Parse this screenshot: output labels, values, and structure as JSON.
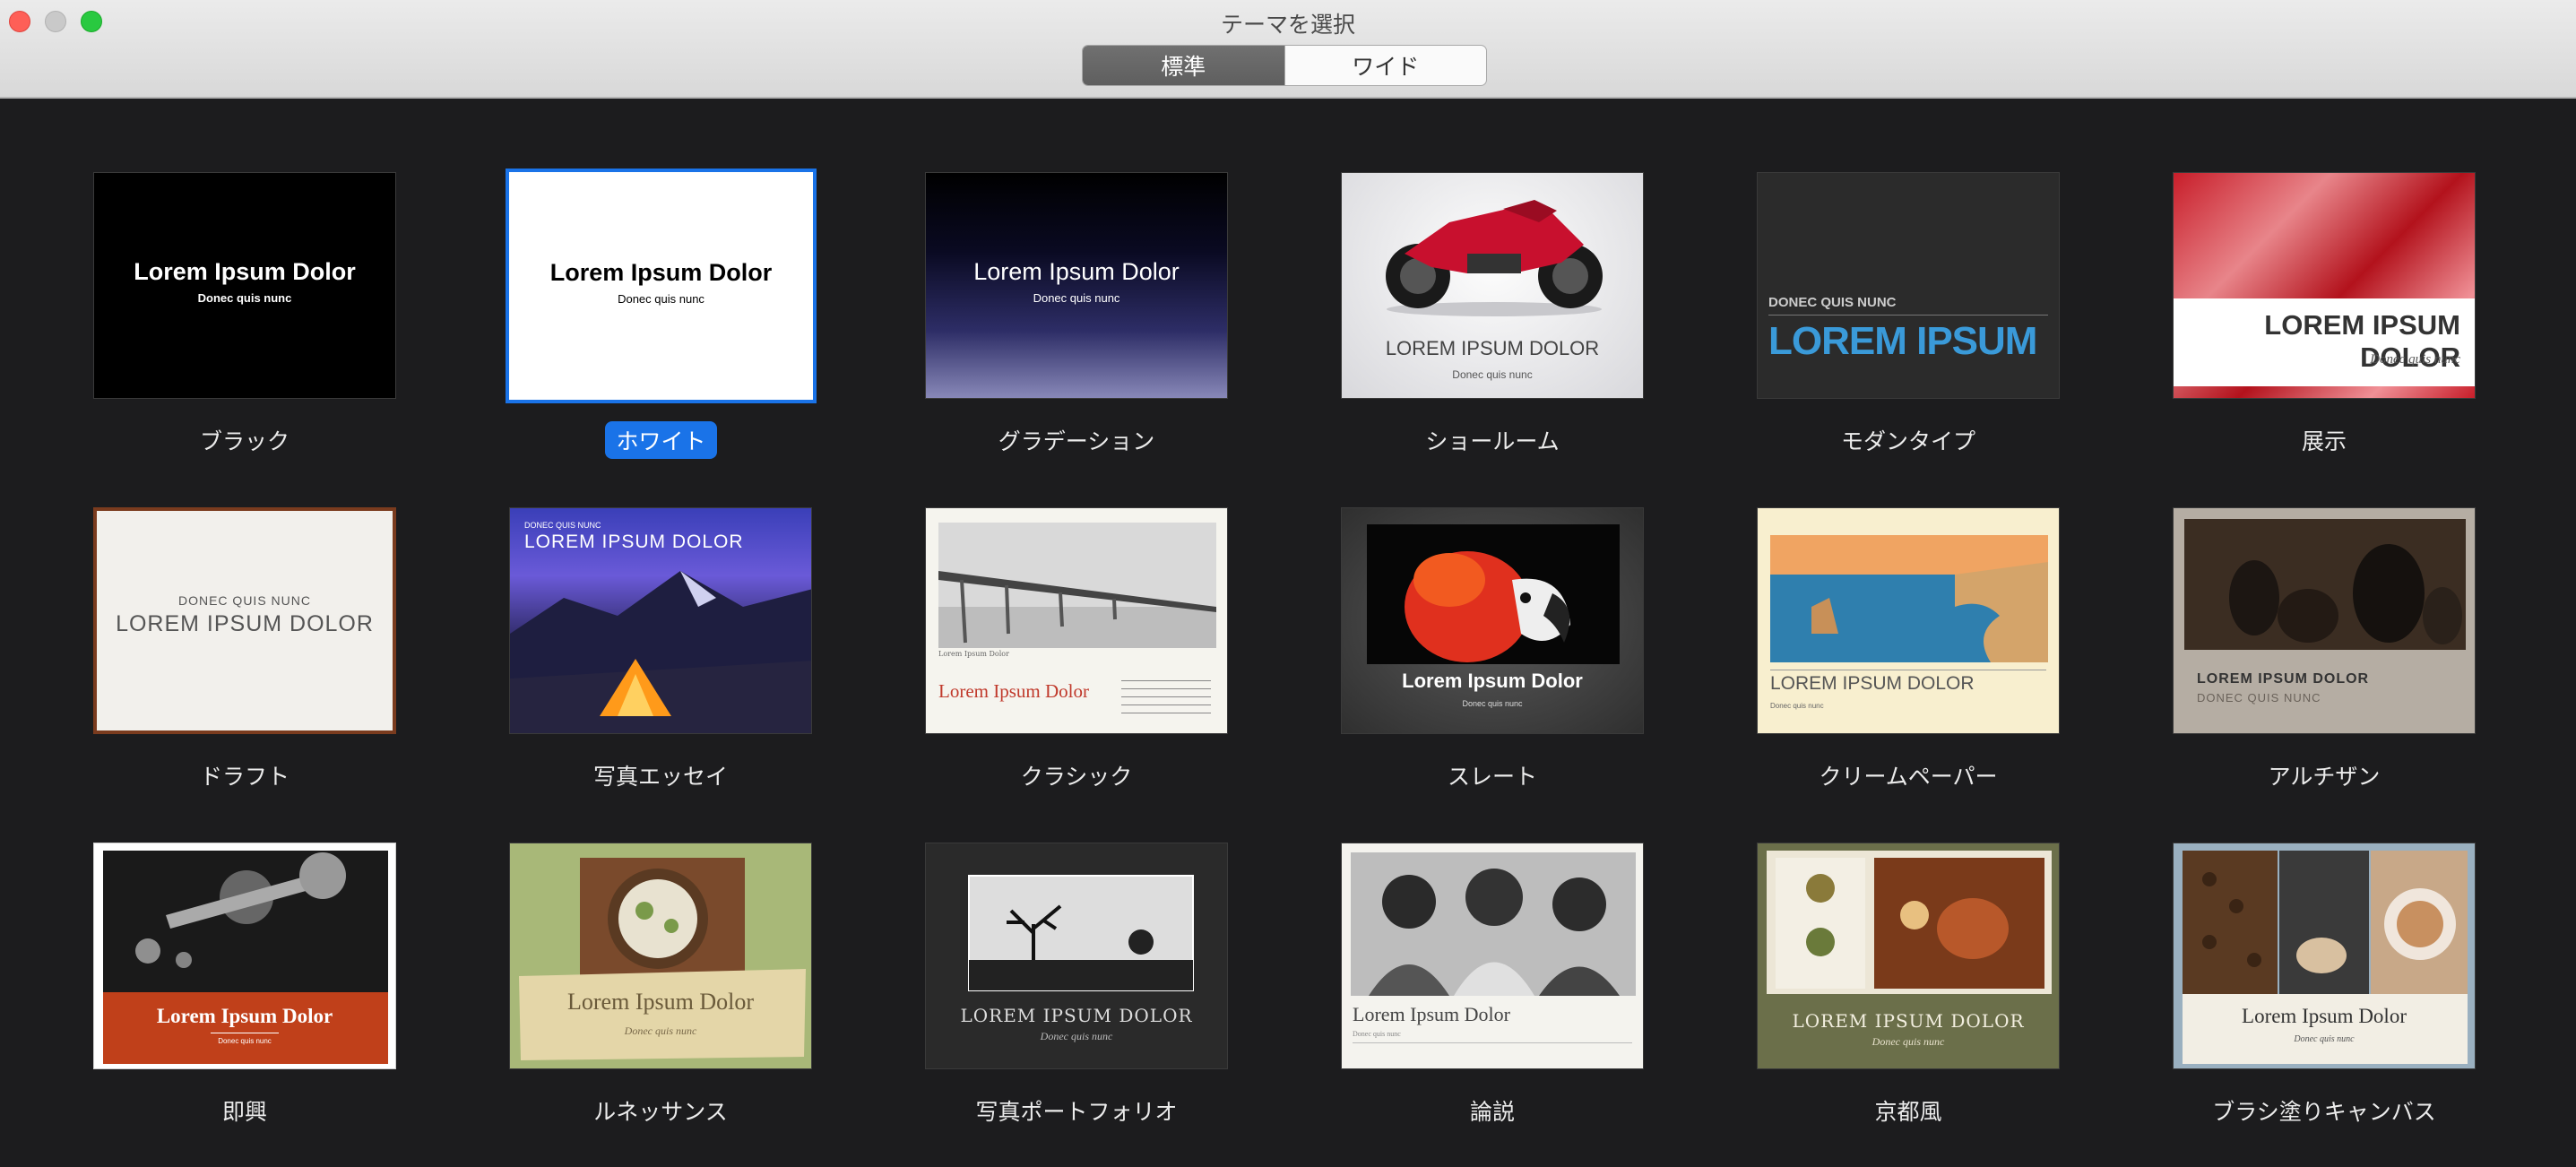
{
  "window": {
    "title": "テーマを選択",
    "segments": [
      "標準",
      "ワイド"
    ],
    "active_segment": 0
  },
  "themes": [
    {
      "name": "ブラック",
      "slide_title": "Lorem Ipsum Dolor",
      "slide_sub": "Donec quis nunc"
    },
    {
      "name": "ホワイト",
      "slide_title": "Lorem Ipsum Dolor",
      "slide_sub": "Donec quis nunc",
      "selected": true
    },
    {
      "name": "グラデーション",
      "slide_title": "Lorem Ipsum Dolor",
      "slide_sub": "Donec quis nunc"
    },
    {
      "name": "ショールーム",
      "slide_title": "LOREM IPSUM DOLOR",
      "slide_sub": "Donec quis nunc"
    },
    {
      "name": "モダンタイプ",
      "slide_title": "LOREM IPSUM",
      "slide_sub": "DONEC QUIS NUNC"
    },
    {
      "name": "展示",
      "slide_title": "LOREM IPSUM DOLOR",
      "slide_sub": "Donec quis nunc"
    },
    {
      "name": "ドラフト",
      "slide_title": "LOREM IPSUM DOLOR",
      "slide_sub": "DONEC QUIS NUNC"
    },
    {
      "name": "写真エッセイ",
      "slide_title": "LOREM IPSUM DOLOR",
      "slide_sub": "DONEC QUIS NUNC"
    },
    {
      "name": "クラシック",
      "slide_title": "Lorem Ipsum Dolor",
      "slide_sub": "Lorem Ipsum Dolor"
    },
    {
      "name": "スレート",
      "slide_title": "Lorem Ipsum Dolor",
      "slide_sub": "Donec quis nunc"
    },
    {
      "name": "クリームペーパー",
      "slide_title": "LOREM IPSUM DOLOR",
      "slide_sub": "Donec quis nunc"
    },
    {
      "name": "アルチザン",
      "slide_title": "LOREM IPSUM DOLOR",
      "slide_sub": "DONEC QUIS NUNC"
    },
    {
      "name": "即興",
      "slide_title": "Lorem Ipsum Dolor",
      "slide_sub": "Donec quis nunc"
    },
    {
      "name": "ルネッサンス",
      "slide_title": "Lorem Ipsum Dolor",
      "slide_sub": "Donec quis nunc"
    },
    {
      "name": "写真ポートフォリオ",
      "slide_title": "LOREM IPSUM DOLOR",
      "slide_sub": "Donec quis nunc"
    },
    {
      "name": "論説",
      "slide_title": "Lorem Ipsum Dolor",
      "slide_sub": "Donec quis nunc"
    },
    {
      "name": "京都風",
      "slide_title": "LOREM IPSUM DOLOR",
      "slide_sub": "Donec quis nunc"
    },
    {
      "name": "ブラシ塗りキャンバス",
      "slide_title": "Lorem Ipsum Dolor",
      "slide_sub": "Donec quis nunc"
    }
  ],
  "colors": {
    "accent": "#1a73e8",
    "background": "#1c1c1e"
  }
}
